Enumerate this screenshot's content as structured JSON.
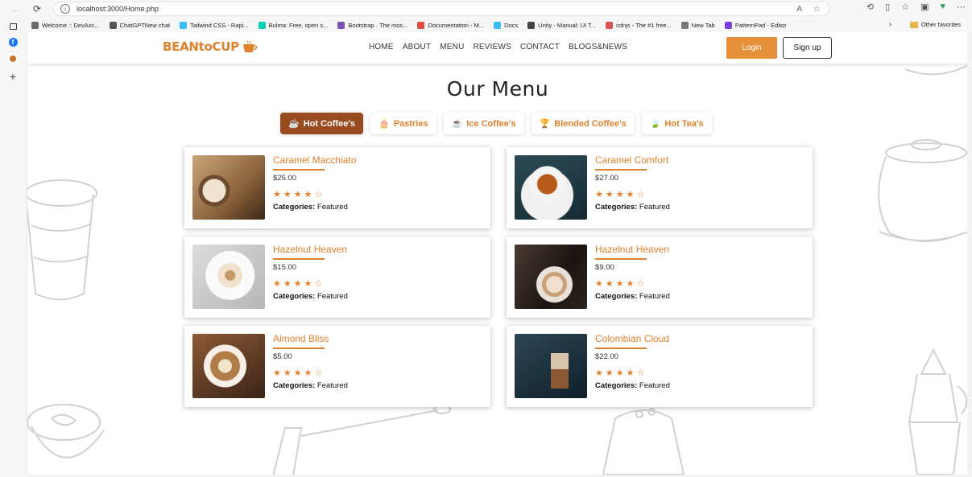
{
  "browser": {
    "url": "localhost:3000/Home.php",
    "bookmarks": [
      {
        "label": "Welcome :: DevAxc...",
        "color": "#6b6b6b"
      },
      {
        "label": "ChatGPTNew chat",
        "color": "#555555"
      },
      {
        "label": "Tailwind CSS - Rapi...",
        "color": "#38bdf8"
      },
      {
        "label": "Bulma: Free, open s...",
        "color": "#00d1b2"
      },
      {
        "label": "Bootstrap · The mos...",
        "color": "#7952b3"
      },
      {
        "label": "Documentation - M...",
        "color": "#e14c3f"
      },
      {
        "label": "Docs",
        "color": "#38bdf8"
      },
      {
        "label": "Unity - Manual: UI T...",
        "color": "#444444"
      },
      {
        "label": "cdnjs - The #1 free...",
        "color": "#d9534f"
      },
      {
        "label": "New Tab",
        "color": "#777777"
      },
      {
        "label": "PatternPad - Editor",
        "color": "#7b3fe4"
      }
    ],
    "other_favorites": "Other favorites"
  },
  "header": {
    "logo": "BEANtoCUP",
    "nav": [
      "HOME",
      "ABOUT",
      "MENU",
      "REVIEWS",
      "CONTACT",
      "BLOGS&NEWS"
    ],
    "login": "Login",
    "signup": "Sign up"
  },
  "main": {
    "title": "Our Menu",
    "tabs": [
      {
        "label": "Hot Coffee's",
        "icon": "☕",
        "active": true
      },
      {
        "label": "Pastries",
        "icon": "🎂",
        "active": false
      },
      {
        "label": "Ice Coffee's",
        "icon": "☕",
        "active": false
      },
      {
        "label": "Blended Coffee's",
        "icon": "🏆",
        "active": false
      },
      {
        "label": "Hot Tea's",
        "icon": "🍃",
        "active": false
      }
    ],
    "products": [
      {
        "name": "Caramel Macchiato",
        "price": "$25.00",
        "stars": "★★★★☆",
        "category_label": "Categories:",
        "category": "Featured",
        "photo": "latte-art-cup"
      },
      {
        "name": "Caramel Comfort",
        "price": "$27.00",
        "stars": "★★★★☆",
        "category_label": "Categories:",
        "category": "Featured",
        "photo": "espresso-cup"
      },
      {
        "name": "Hazelnut Heaven",
        "price": "$15.00",
        "stars": "★★★★☆",
        "category_label": "Categories:",
        "category": "Featured",
        "photo": "cappuccino-saucer"
      },
      {
        "name": "Hazelnut Heaven",
        "price": "$9.00",
        "stars": "★★★★☆",
        "category_label": "Categories:",
        "category": "Featured",
        "photo": "barista-pour"
      },
      {
        "name": "Almond Bliss",
        "price": "$5.00",
        "stars": "★★★★☆",
        "category_label": "Categories:",
        "category": "Featured",
        "photo": "latte-art-table"
      },
      {
        "name": "Colombian Cloud",
        "price": "$22.00",
        "stars": "★★★★☆",
        "category_label": "Categories:",
        "category": "Featured",
        "photo": "iced-latte-glass"
      }
    ]
  },
  "colors": {
    "accent": "#e0812e",
    "active_tab": "#9a4a1f",
    "login_bg": "#e6913a"
  }
}
